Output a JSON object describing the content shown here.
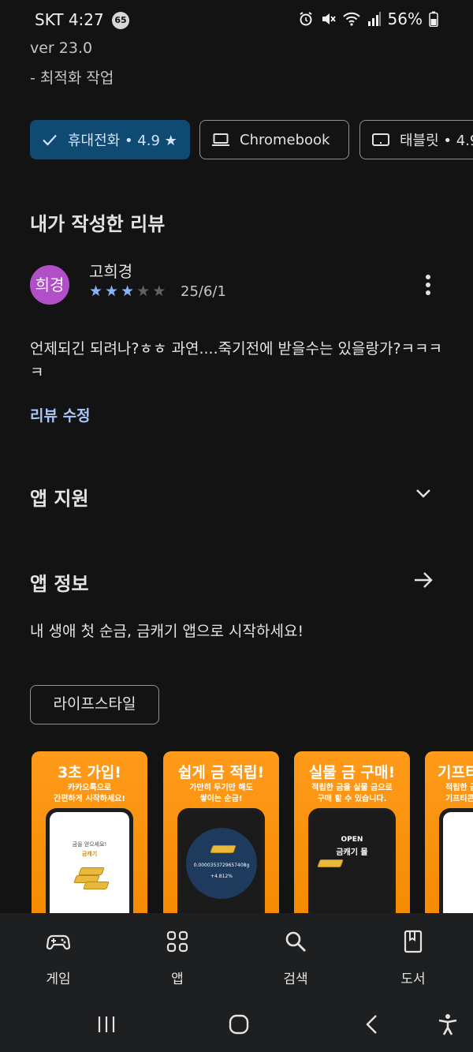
{
  "status_bar": {
    "carrier": "SKT 4:27",
    "notification_badge": "65",
    "battery": "56%",
    "icons": [
      "alarm-icon",
      "mute-icon",
      "wifi-icon",
      "signal-icon",
      "battery-icon"
    ]
  },
  "whats_new": {
    "version": "ver 23.0",
    "change": "- 최적화 작업"
  },
  "device_chips": [
    {
      "label": "휴대전화 • 4.9 ★",
      "selected": true,
      "icon": "check-icon"
    },
    {
      "label": "Chromebook",
      "selected": false,
      "icon": "laptop-icon"
    },
    {
      "label": "태블릿 • 4.9",
      "selected": false,
      "icon": "tablet-icon"
    }
  ],
  "my_review": {
    "section_title": "내가 작성한 리뷰",
    "avatar_text": "희경",
    "reviewer_name": "고희경",
    "rating": 3,
    "max_rating": 5,
    "date": "25/6/1",
    "text": "언제되긴 되려나?ㅎㅎ 과연....죽기전에 받을수는 있을랑가?ㅋㅋㅋㅋ",
    "edit_label": "리뷰 수정"
  },
  "app_support": {
    "title": "앱 지원"
  },
  "app_info": {
    "title": "앱 정보",
    "description": "내 생애 첫 순금, 금캐기 앱으로 시작하세요!",
    "category": "라이프스타일"
  },
  "screenshots": [
    {
      "headline": "3초 가입!",
      "sub": "카카오톡으로\n간편하게 시작하세요!",
      "screen_text_1": "금을 얻으세요!",
      "screen_text_2": "금캐기"
    },
    {
      "headline": "쉽게 금 적립!",
      "sub": "가만히 두기만 해도\n쌓이는 순금!",
      "screen_text_1": "0.0000353729657408g",
      "screen_text_2": "+4.812%"
    },
    {
      "headline": "실물 금 구매!",
      "sub": "적립한 금을 실물 금으로\n구매 할 수 있습니다.",
      "screen_text_1": "OPEN",
      "screen_text_2": "금캐기 몰"
    },
    {
      "headline": "기프티",
      "sub": "적립한 금\n기프티콘",
      "screen_text_1": "",
      "screen_text_2": ""
    }
  ],
  "bottom_nav": [
    {
      "label": "게임",
      "icon": "gamepad-icon"
    },
    {
      "label": "앱",
      "icon": "apps-grid-icon"
    },
    {
      "label": "검색",
      "icon": "search-icon"
    },
    {
      "label": "도서",
      "icon": "book-icon"
    }
  ],
  "system_nav": [
    "recents-icon",
    "home-icon",
    "back-icon",
    "accessibility-icon"
  ],
  "colors": {
    "background": "#131314",
    "selected_chip": "#0f4a73",
    "link": "#a8c7fa",
    "star": "#8ab4f8",
    "avatar": "#b04fc8",
    "screenshot_orange": "#f58a00"
  }
}
